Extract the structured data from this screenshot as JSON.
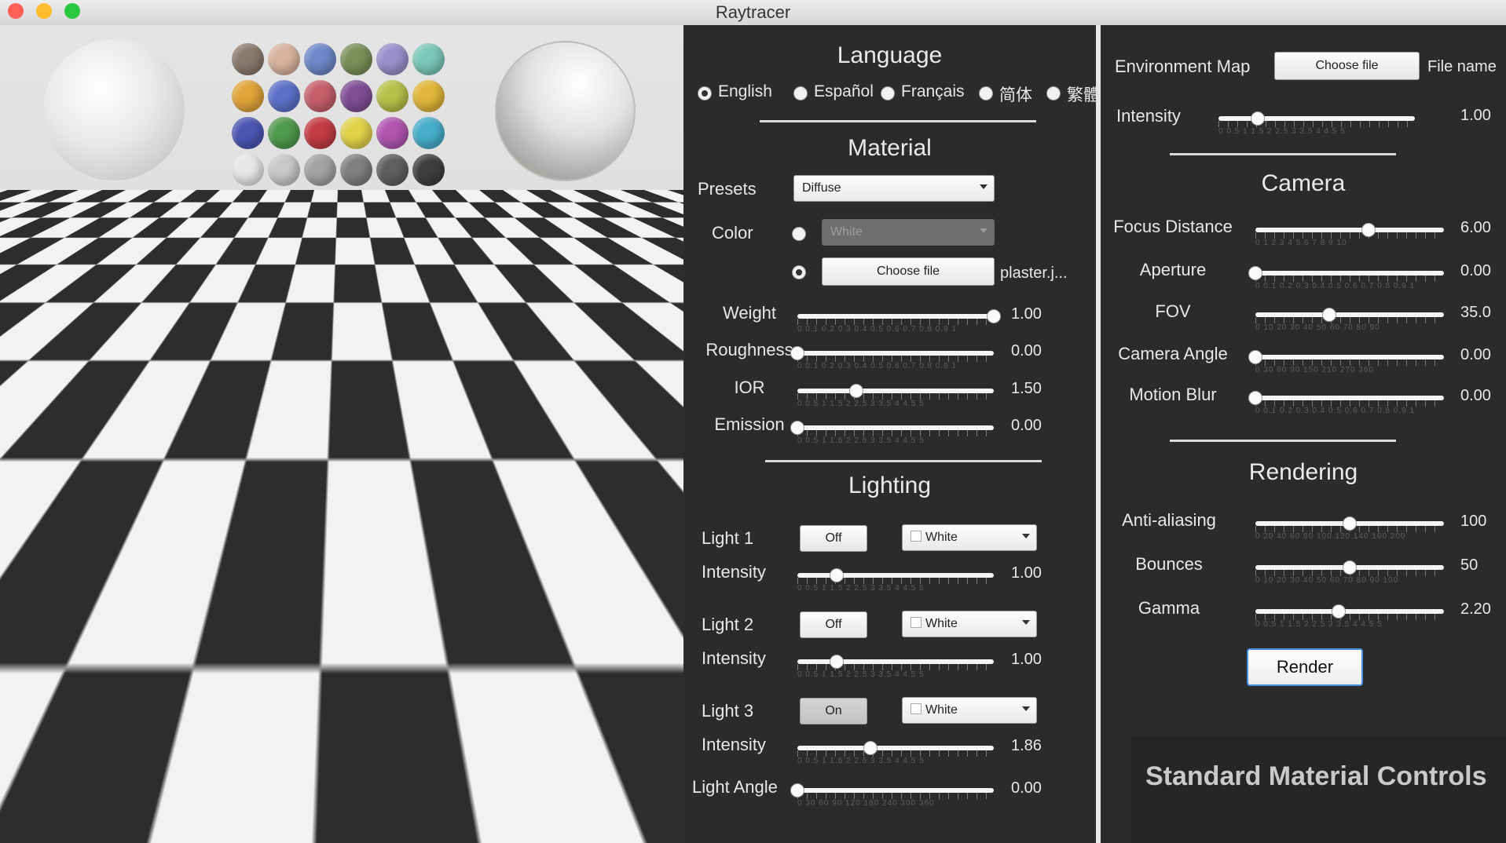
{
  "window": {
    "title": "Raytracer",
    "controls": {
      "close_color": "#fe5f57",
      "minimize_color": "#febc2e",
      "zoom_color": "#28c840"
    }
  },
  "viewport": {
    "sphere_material": "plaster texture",
    "swatch_colors": [
      "#8a7a6c",
      "#d8b3a0",
      "#6f87c8",
      "#7b8f5a",
      "#9890cc",
      "#7cc9b8",
      "#e0a43a",
      "#5e70c9",
      "#c5606a",
      "#7e4e95",
      "#b5c24a",
      "#e2b63c",
      "#4a56b2",
      "#4f9a4e",
      "#c23b45",
      "#e0d34a",
      "#b155b0",
      "#47aecb",
      "#e7e7e7",
      "#c8c8c8",
      "#a3a3a3",
      "#7f7f7f",
      "#5f5f5f",
      "#3e3e3e"
    ]
  },
  "language": {
    "heading": "Language",
    "options": [
      "English",
      "Español",
      "Français",
      "简体",
      "繁體"
    ],
    "selected": "English"
  },
  "material": {
    "heading": "Material",
    "presets_label": "Presets",
    "preset_value": "Diffuse",
    "color_label": "Color",
    "color_value": "White",
    "choose_file": "Choose file",
    "file_name": "plaster.j...",
    "sliders": [
      {
        "label": "Weight",
        "value": "1.00",
        "fraction": 1.0,
        "scale": "0 0.1 0.2 0.3 0.4 0.5 0.6 0.7 0.8 0.9 1"
      },
      {
        "label": "Roughness",
        "value": "0.00",
        "fraction": 0.0,
        "scale": "0 0.1 0.2 0.3 0.4 0.5 0.6 0.7 0.8 0.9 1"
      },
      {
        "label": "IOR",
        "value": "1.50",
        "fraction": 0.3,
        "scale": "0 0.5 1 1.5 2 2.5 3 3.5 4 4.5 5"
      },
      {
        "label": "Emission",
        "value": "0.00",
        "fraction": 0.0,
        "scale": "0 0.5 1 1.5 2 2.5 3 3.5 4 4.5 5"
      }
    ]
  },
  "lighting": {
    "heading": "Lighting",
    "lights": [
      {
        "label": "Light 1",
        "state": "Off",
        "color": "White",
        "intensity_label": "Intensity",
        "intensity": "1.00",
        "fraction": 0.2
      },
      {
        "label": "Light 2",
        "state": "Off",
        "color": "White",
        "intensity_label": "Intensity",
        "intensity": "1.00",
        "fraction": 0.2
      },
      {
        "label": "Light 3",
        "state": "On",
        "color": "White",
        "intensity_label": "Intensity",
        "intensity": "1.86",
        "fraction": 0.372
      }
    ],
    "intensity_scale": "0 0.5 1 1.5 2 2.5 3 3.5 4 4.5 5",
    "angle_label": "Light Angle",
    "angle_value": "0.00",
    "angle_fraction": 0.0,
    "angle_scale": "0 30 60 90 120 180 240 300 360"
  },
  "environment": {
    "map_label": "Environment Map",
    "choose_file": "Choose file",
    "file_name": "File name",
    "intensity_label": "Intensity",
    "intensity": "1.00",
    "fraction": 0.2,
    "scale": "0 0.5 1 1.5 2 2.5 3 3.5 4 4.5 5"
  },
  "camera": {
    "heading": "Camera",
    "sliders": [
      {
        "label": "Focus Distance",
        "value": "6.00",
        "fraction": 0.6,
        "scale": "0 1 2 3 4 5 6 7 8 9 10"
      },
      {
        "label": "Aperture",
        "value": "0.00",
        "fraction": 0.0,
        "scale": "0 0.1 0.2 0.3 0.4 0.5 0.6 0.7 0.8 0.9 1"
      },
      {
        "label": "FOV",
        "value": "35.0",
        "fraction": 0.39,
        "scale": "0 10 20 30 40 50 60 70 80 90"
      },
      {
        "label": "Camera Angle",
        "value": "0.00",
        "fraction": 0.0,
        "scale": "0 30 60 90 150 210 270 360"
      },
      {
        "label": "Motion Blur",
        "value": "0.00",
        "fraction": 0.0,
        "scale": "0 0.1 0.2 0.3 0.4 0.5 0.6 0.7 0.8 0.9 1"
      }
    ]
  },
  "rendering": {
    "heading": "Rendering",
    "sliders": [
      {
        "label": "Anti-aliasing",
        "value": "100",
        "fraction": 0.5,
        "scale": "0 20 40 60 80 100 120 140 160 200"
      },
      {
        "label": "Bounces",
        "value": "50",
        "fraction": 0.5,
        "scale": "0 10 20 30 40 50 60 70 80 90 100"
      },
      {
        "label": "Gamma",
        "value": "2.20",
        "fraction": 0.44,
        "scale": "0 0.5 1 1.5 2 2.5 3 3.5 4 4.5 5"
      }
    ],
    "render_button": "Render"
  },
  "caption": "Standard Material Controls"
}
